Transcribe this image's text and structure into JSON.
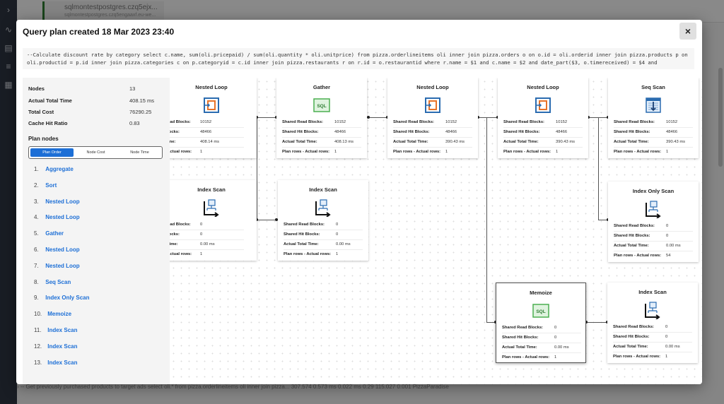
{
  "background": {
    "connection_name": "sqlmontestpostgres.czq5ejx...",
    "connection_host": "sqlmontestpostgres.czq5engaaxf.eu-we...",
    "row_text": "›   -- Get previously purchased products to target ads select oli.* from pizza.orderlineitems oli inner join pizza...       307.574       0.573 ms       0.022 ms       0.29       115.027       0.001       PizzaParadise"
  },
  "modal": {
    "title": "Query plan created 18 Mar 2023 23:40",
    "close_label": "×",
    "query": "--Calculate discount rate by category select c.name, sum(oli.pricepaid) / sum(oli.quantity * oli.unitprice) from pizza.orderlineitems oli inner join pizza.orders o on o.id = oli.orderid inner join pizza.products p on oli.productid = p.id inner join pizza.categories c on p.categoryid = c.id inner join pizza.restaurants r on r.id = o.restaurantid where r.name = $1 and c.name = $2 and date_part($3, o.timereceived) = $4 and"
  },
  "summary": {
    "nodes_label": "Nodes",
    "nodes_value": "13",
    "total_time_label": "Actual Total Time",
    "total_time_value": "408.15 ms",
    "total_cost_label": "Total Cost",
    "total_cost_value": "76290.25",
    "cache_label": "Cache Hit Ratio",
    "cache_value": "0.83"
  },
  "plan_nodes": {
    "title": "Plan nodes",
    "tabs": [
      "Plan Order",
      "Node Cost",
      "Node Time"
    ],
    "active_tab": "Plan Order",
    "items": [
      {
        "num": "1.",
        "name": "Aggregate"
      },
      {
        "num": "2.",
        "name": "Sort"
      },
      {
        "num": "3.",
        "name": "Nested Loop"
      },
      {
        "num": "4.",
        "name": "Nested Loop"
      },
      {
        "num": "5.",
        "name": "Gather"
      },
      {
        "num": "6.",
        "name": "Nested Loop"
      },
      {
        "num": "7.",
        "name": "Nested Loop"
      },
      {
        "num": "8.",
        "name": "Seq Scan"
      },
      {
        "num": "9.",
        "name": "Index Only Scan"
      },
      {
        "num": "10.",
        "name": "Memoize"
      },
      {
        "num": "11.",
        "name": "Index Scan"
      },
      {
        "num": "12.",
        "name": "Index Scan"
      },
      {
        "num": "13.",
        "name": "Index Scan"
      }
    ]
  },
  "cards": [
    {
      "title": "Nested Loop",
      "icon": "nested-loop-icon",
      "rows": [
        {
          "k": "Read Blocks:",
          "v": "10152"
        },
        {
          "k": "Blocks:",
          "v": "48466"
        },
        {
          "k": "Time:",
          "v": "408.14 ms"
        },
        {
          "k": "- Actual rows:",
          "v": "1"
        }
      ]
    },
    {
      "title": "Gather",
      "icon": "sql-icon",
      "rows": [
        {
          "k": "Shared Read Blocks:",
          "v": "10152"
        },
        {
          "k": "Shared Hit Blocks:",
          "v": "48466"
        },
        {
          "k": "Actual Total Time:",
          "v": "408.13 ms"
        },
        {
          "k": "Plan rows - Actual rows:",
          "v": "1"
        }
      ]
    },
    {
      "title": "Nested Loop",
      "icon": "nested-loop-icon",
      "rows": [
        {
          "k": "Shared Read Blocks:",
          "v": "10152"
        },
        {
          "k": "Shared Hit Blocks:",
          "v": "48466"
        },
        {
          "k": "Actual Total Time:",
          "v": "390.43 ms"
        },
        {
          "k": "Plan rows - Actual rows:",
          "v": "1"
        }
      ]
    },
    {
      "title": "Nested Loop",
      "icon": "nested-loop-icon",
      "rows": [
        {
          "k": "Shared Read Blocks:",
          "v": "10152"
        },
        {
          "k": "Shared Hit Blocks:",
          "v": "48466"
        },
        {
          "k": "Actual Total Time:",
          "v": "390.43 ms"
        },
        {
          "k": "Plan rows - Actual rows:",
          "v": "1"
        }
      ]
    },
    {
      "title": "Seq Scan",
      "icon": "seq-scan-icon",
      "rows": [
        {
          "k": "Shared Read Blocks:",
          "v": "10152"
        },
        {
          "k": "Shared Hit Blocks:",
          "v": "48466"
        },
        {
          "k": "Actual Total Time:",
          "v": "390.43 ms"
        },
        {
          "k": "Plan rows - Actual rows:",
          "v": "1"
        }
      ]
    },
    {
      "title": "Index Scan",
      "icon": "index-scan-icon",
      "rows": [
        {
          "k": "Read Blocks:",
          "v": "0"
        },
        {
          "k": "Blocks:",
          "v": "0"
        },
        {
          "k": "l Time:",
          "v": "0.00 ms"
        },
        {
          "k": "- Actual rows:",
          "v": "1"
        }
      ]
    },
    {
      "title": "Index Scan",
      "icon": "index-scan-icon",
      "rows": [
        {
          "k": "Shared Read Blocks:",
          "v": "0"
        },
        {
          "k": "Shared Hit Blocks:",
          "v": "0"
        },
        {
          "k": "Actual Total Time:",
          "v": "0.00 ms"
        },
        {
          "k": "Plan rows - Actual rows:",
          "v": "1"
        }
      ]
    },
    {
      "title": "Index Only Scan",
      "icon": "index-only-scan-icon",
      "rows": [
        {
          "k": "Shared Read Blocks:",
          "v": "0"
        },
        {
          "k": "Shared Hit Blocks:",
          "v": "0"
        },
        {
          "k": "Actual Total Time:",
          "v": "0.00 ms"
        },
        {
          "k": "Plan rows - Actual rows:",
          "v": "54"
        }
      ]
    },
    {
      "title": "Memoize",
      "icon": "memoize-sql-icon",
      "rows": [
        {
          "k": "Shared Read Blocks:",
          "v": "0"
        },
        {
          "k": "Shared Hit Blocks:",
          "v": "0"
        },
        {
          "k": "Actual Total Time:",
          "v": "0.00 ms"
        },
        {
          "k": "Plan rows - Actual rows:",
          "v": "1"
        }
      ]
    },
    {
      "title": "Index Scan",
      "icon": "index-scan-icon",
      "rows": [
        {
          "k": "Shared Read Blocks:",
          "v": "0"
        },
        {
          "k": "Shared Hit Blocks:",
          "v": "0"
        },
        {
          "k": "Actual Total Time:",
          "v": "0.00 ms"
        },
        {
          "k": "Plan rows - Actual rows:",
          "v": "1"
        }
      ]
    }
  ],
  "colors": {
    "accent": "#1d6fd6",
    "loop_orange": "#e8732a",
    "sql_green": "#4caf50"
  }
}
